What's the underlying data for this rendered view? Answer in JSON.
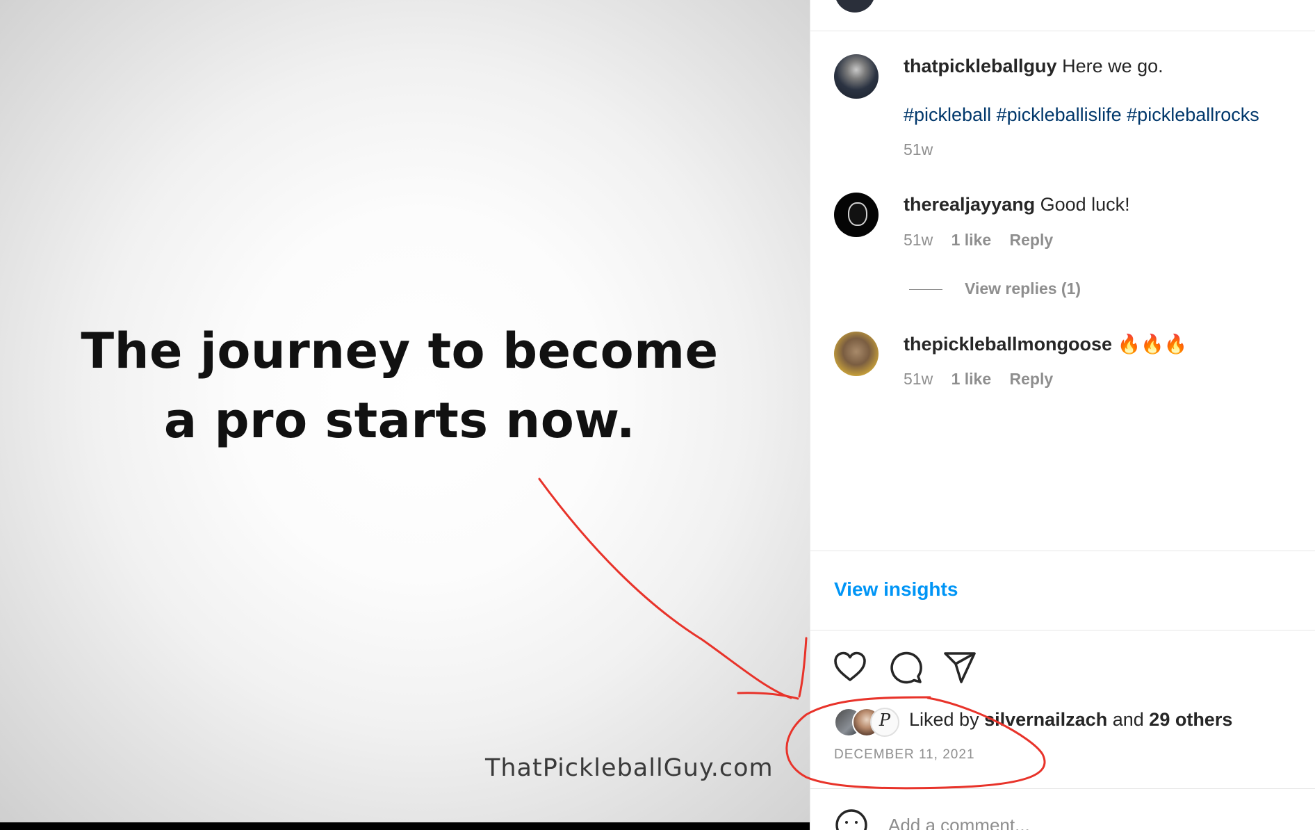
{
  "media": {
    "headline_line1": "The journey to become",
    "headline_line2": "a pro starts now.",
    "watermark": "ThatPickleballGuy.com"
  },
  "caption": {
    "username": "thatpickleballguy",
    "text": "Here we go.",
    "hashtags": "#pickleball #pickleballislife #pickleballrocks",
    "time": "51w"
  },
  "comments": [
    {
      "username": "therealjayyang",
      "text": "Good luck!",
      "time": "51w",
      "likes": "1 like",
      "reply": "Reply",
      "view_replies": "View replies (1)"
    },
    {
      "username": "thepickleballmongoose",
      "text": "🔥🔥🔥",
      "time": "51w",
      "likes": "1 like",
      "reply": "Reply"
    }
  ],
  "insights_label": "View insights",
  "actions": {
    "like_icon": "heart-icon",
    "comment_icon": "speech-bubble-icon",
    "share_icon": "paper-plane-icon"
  },
  "likes": {
    "prefix": "Liked by",
    "user": "silvernailzach",
    "middle": "and",
    "others": "29 others",
    "avatar_letter": "P"
  },
  "date": "DECEMBER 11, 2021",
  "comment_input": {
    "placeholder": "Add a comment..."
  },
  "colors": {
    "link_blue": "#0095f6",
    "hashtag_blue": "#00376b",
    "muted_gray": "#8e8e8e",
    "text_dark": "#262626",
    "annotation_red": "#e8332a"
  }
}
